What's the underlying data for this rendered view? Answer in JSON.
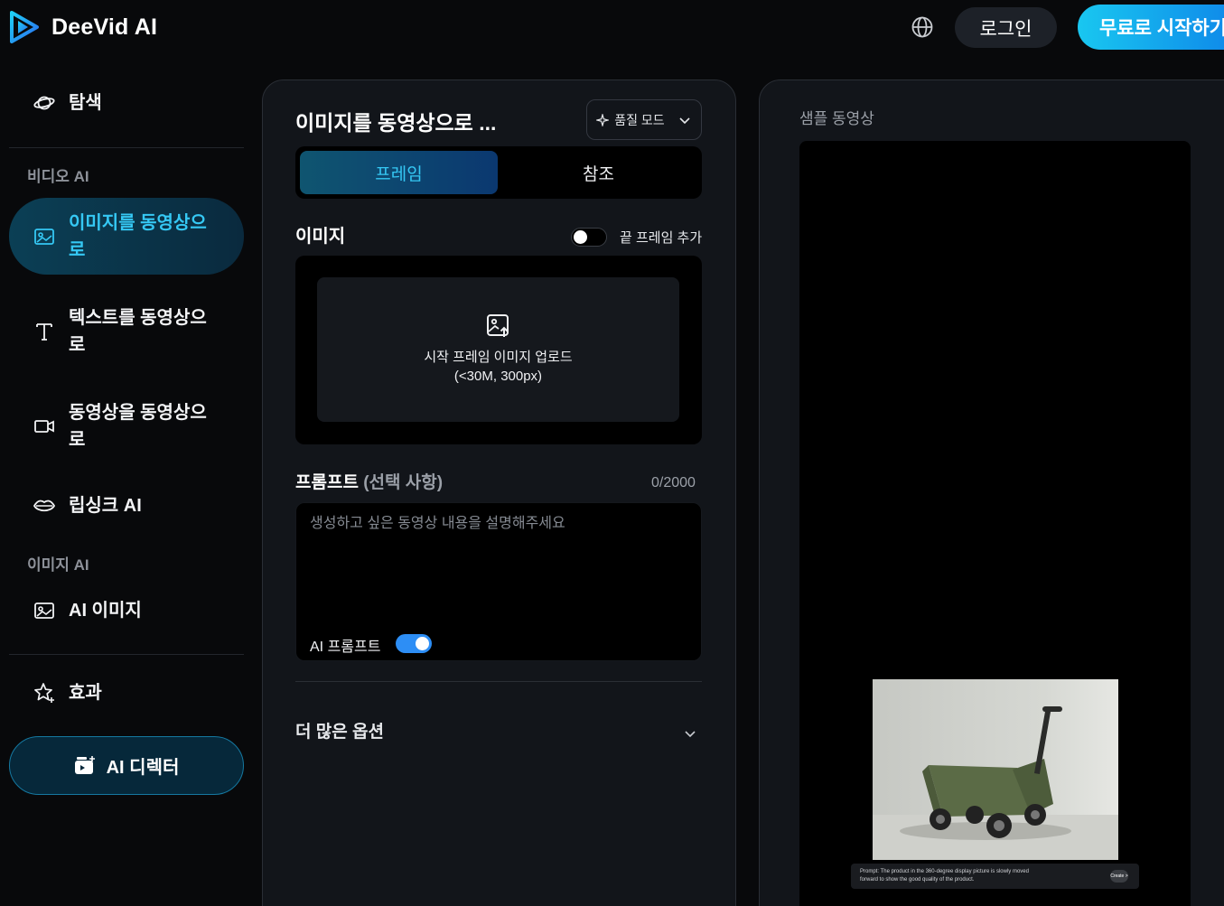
{
  "brand": {
    "name": "DeeVid AI"
  },
  "header": {
    "login_label": "로그인",
    "start_label": "무료로 시작하기"
  },
  "sidebar": {
    "explore_label": "탐색",
    "video_section": "비디오 AI",
    "items": [
      {
        "label": "이미지를 동영상으로",
        "icon": "image-icon",
        "active": true
      },
      {
        "label": "텍스트를 동영상으로",
        "icon": "text-icon",
        "active": false
      },
      {
        "label": "동영상을 동영상으로",
        "icon": "video-camera-icon",
        "active": false
      },
      {
        "label": "립싱크 AI",
        "icon": "lips-icon",
        "active": false
      }
    ],
    "image_section": "이미지 AI",
    "ai_image_label": "AI 이미지",
    "effects_label": "효과",
    "director_label": "AI 디렉터"
  },
  "editor": {
    "title": "이미지를 동영상으로 ...",
    "quality_label": "품질 모드",
    "tabs": [
      "프레임",
      "참조"
    ],
    "image_label": "이미지",
    "end_frame_label": "끝 프레임 추가",
    "end_frame_enabled": false,
    "upload_line1": "시작 프레임 이미지 업로드",
    "upload_line2": "(<30M, 300px)",
    "prompt_label": "프롬프트",
    "prompt_optional": "(선택 사항)",
    "prompt_counter": "0/2000",
    "prompt_value": "",
    "prompt_placeholder": "생성하고 싶은 동영상 내용을 설명해주세요",
    "ai_prompt_label": "AI 프롬프트",
    "ai_prompt_enabled": true,
    "more_options_label": "더 많은 옵션"
  },
  "sample": {
    "title": "샘플 동영상",
    "caption_line1": "Prompt:  The product in the 360-degree display picture is slowly moved",
    "caption_line2": "forward to show the good quality of the product.",
    "create_label": "Create >"
  },
  "colors": {
    "accent": "#35c8f4",
    "toggle_on": "#2d8ef5",
    "start_gradient_start": "#19c7f0",
    "start_gradient_end": "#0d7fe8"
  }
}
